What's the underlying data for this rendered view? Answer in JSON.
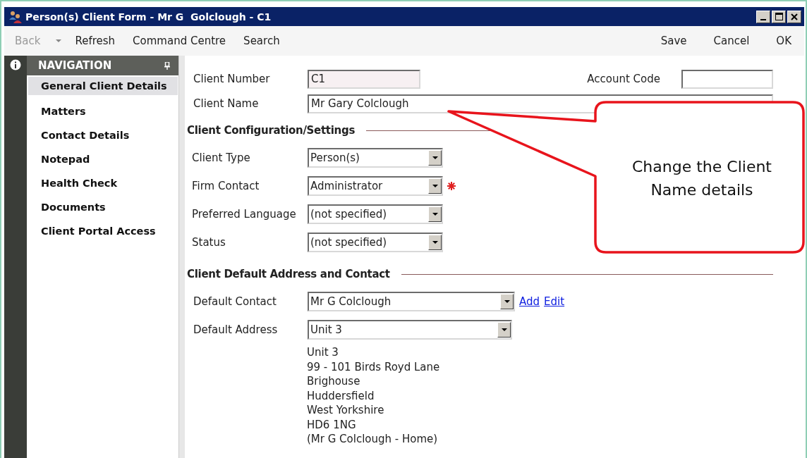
{
  "window": {
    "title": "Person(s) Client Form - Mr G  Golclough - C1"
  },
  "toolbar": {
    "left": [
      {
        "label": "Back",
        "disabled": true,
        "kind": "dropdown"
      },
      {
        "label": "Refresh",
        "disabled": false,
        "kind": "button"
      },
      {
        "label": "Command Centre",
        "disabled": false,
        "kind": "button"
      },
      {
        "label": "Search",
        "disabled": false,
        "kind": "button"
      }
    ],
    "right": [
      {
        "label": "Save",
        "disabled": false
      },
      {
        "label": "Cancel",
        "disabled": false
      },
      {
        "label": "OK",
        "disabled": false
      }
    ]
  },
  "navigation": {
    "title": "NAVIGATION",
    "items": [
      {
        "label": "General Client Details",
        "selected": true
      },
      {
        "label": "Matters",
        "selected": false
      },
      {
        "label": "Contact Details",
        "selected": false
      },
      {
        "label": "Notepad",
        "selected": false
      },
      {
        "label": "Health Check",
        "selected": false
      },
      {
        "label": "Documents",
        "selected": false
      },
      {
        "label": "Client Portal Access",
        "selected": false
      }
    ]
  },
  "client_number": {
    "label": "Client Number",
    "value": "C1",
    "readonly": true
  },
  "account_code": {
    "label": "Account Code"
  },
  "client_name": {
    "label": "Client Name",
    "value": "Mr Gary Colclough"
  },
  "configuration": {
    "title": "Client Configuration/Settings",
    "fields": [
      {
        "label": "Client Type",
        "value": "Person(s)",
        "required": false
      },
      {
        "label": "Firm Contact",
        "value": "Administrator",
        "required": true
      },
      {
        "label": "Preferred Language",
        "value": "(not specified)",
        "required": false
      },
      {
        "label": "Status",
        "value": "(not specified)",
        "required": false
      }
    ]
  },
  "address_section": {
    "title": "Client Default Address and Contact",
    "default_contact": {
      "label": "Default Contact",
      "value": "Mr G Colclough",
      "links": [
        "Add",
        "Edit"
      ]
    },
    "default_address": {
      "label": "Default Address",
      "value": "Unit 3"
    },
    "address_lines": [
      "Unit 3",
      "99 - 101 Birds Royd Lane",
      "Brighouse",
      "Huddersfield",
      "West Yorkshire",
      "HD6 1NG",
      "(Mr G Colclough - Home)"
    ]
  },
  "callout": {
    "text": "Change the Client Name details"
  }
}
